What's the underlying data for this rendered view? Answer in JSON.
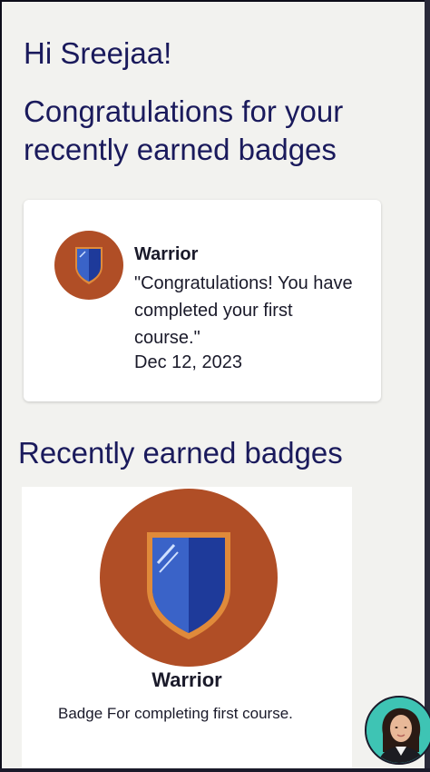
{
  "greeting": "Hi Sreejaa!",
  "congrats_heading": "Congratulations for your recently earned badges",
  "latest_badge": {
    "name": "Warrior",
    "message": "\"Congratulations! You have completed your first course.\"",
    "date": "Dec 12, 2023",
    "icon": "shield-badge-icon"
  },
  "recent_section": {
    "title": "Recently earned badges",
    "badges": [
      {
        "name": "Warrior",
        "description": "Badge For completing first course.",
        "icon": "shield-badge-icon"
      }
    ]
  },
  "assistant": {
    "icon": "assistant-avatar-icon"
  },
  "colors": {
    "heading": "#1a1a5c",
    "badge_bg": "#b04e26",
    "shield_blue": "#1e3a9a",
    "shield_border": "#e08a3a",
    "avatar_bg": "#3ec4b4"
  }
}
